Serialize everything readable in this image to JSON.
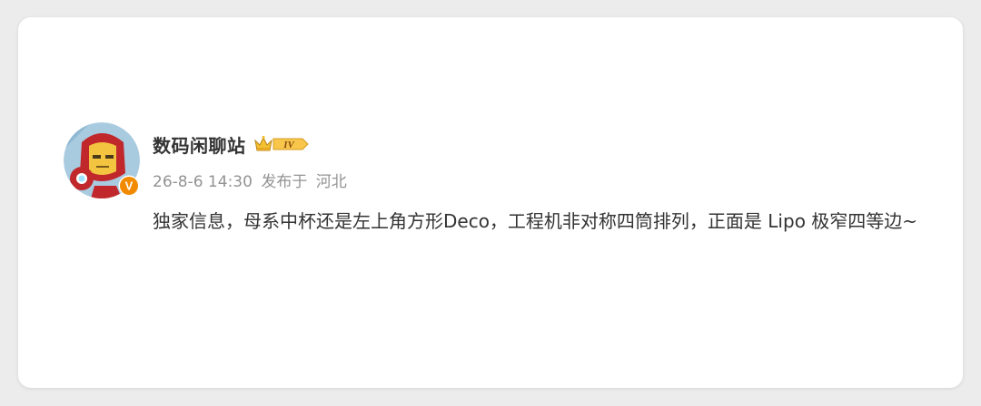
{
  "post": {
    "author": {
      "name": "数码闲聊站",
      "level_badge": "IV",
      "verified_badge": "V",
      "avatar": "iron-man-avatar",
      "verified_color": "#f28a00"
    },
    "timestamp": "26-8-6 14:30",
    "source": "发布于",
    "location": "河北",
    "content": "独家信息，母系中杯还是左上角方形Deco，工程机非对称四筒排列，正面是 Lipo 极窄四等边~"
  }
}
